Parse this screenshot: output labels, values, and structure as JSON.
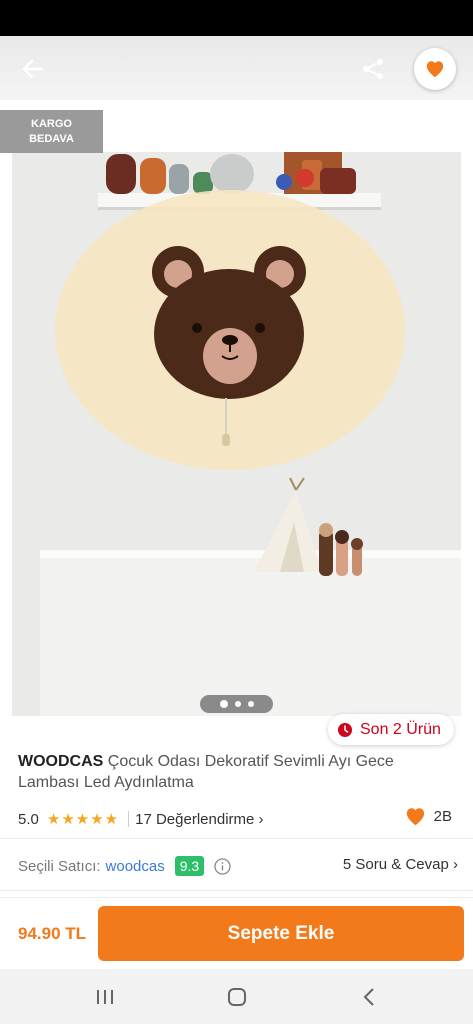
{
  "header": {
    "back_icon": "arrow-left-icon",
    "share_icon": "share-icon",
    "favorite_icon": "heart-icon",
    "accent_color": "#f27a1a"
  },
  "gallery": {
    "badge": "KARGO\nBEDAVA",
    "image_description_icon": "product-photo",
    "pages": 3,
    "active_page": 1
  },
  "stock": {
    "label": "Son 2 Ürün",
    "icon": "clock-icon"
  },
  "product": {
    "brand": "WOODCAS",
    "title": "Çocuk Odası Dekoratif Sevimli Ayı Gece Lambası Led Aydınlatma"
  },
  "rating": {
    "score": "5.0",
    "stars": 5,
    "reviews_label": "17 Değerlendirme",
    "likes": "2B"
  },
  "seller": {
    "label": "Seçili Satıcı:",
    "name": "woodcas",
    "score": "9.3",
    "qa_label": "5 Soru & Cevap"
  },
  "footer": {
    "price": "94.90 TL",
    "cta": "Sepete Ekle"
  }
}
